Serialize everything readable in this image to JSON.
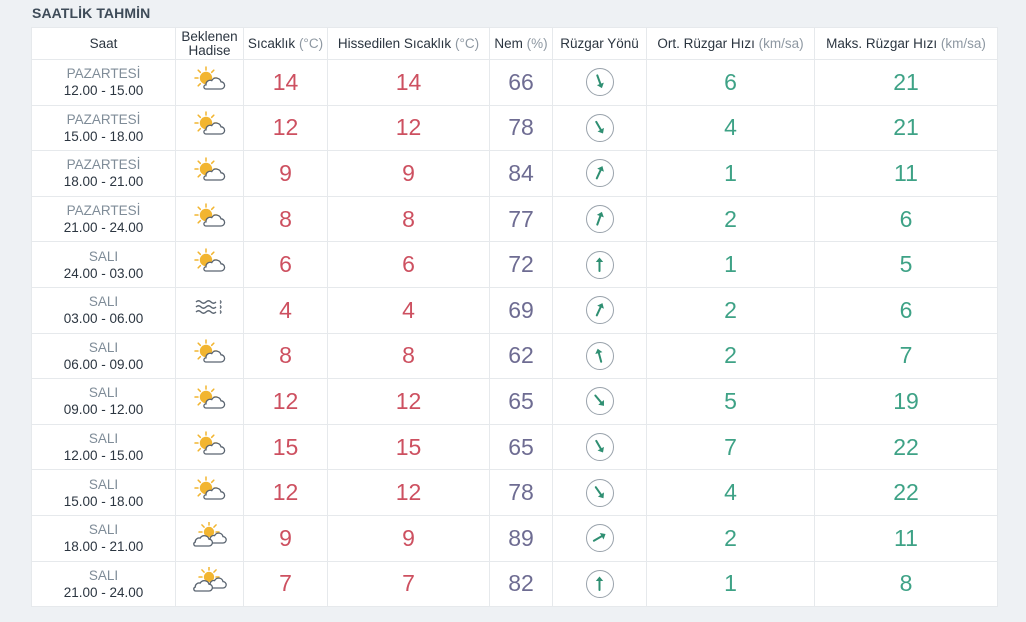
{
  "section_title": "SAATLİK TAHMİN",
  "headers": {
    "saat": "Saat",
    "hadise_line1": "Beklenen",
    "hadise_line2": "Hadise",
    "sicaklik": "Sıcaklık",
    "sicaklik_unit": "(°C)",
    "hissedilen": "Hissedilen Sıcaklık",
    "hissedilen_unit": "(°C)",
    "nem": "Nem",
    "nem_unit": "(%)",
    "ruzgar_yonu": "Rüzgar Yönü",
    "ort_ruzgar": "Ort. Rüzgar Hızı",
    "ort_ruzgar_unit": "(km/sa)",
    "maks_ruzgar": "Maks. Rüzgar Hızı",
    "maks_ruzgar_unit": "(km/sa)"
  },
  "colors": {
    "temperature": "#cd5060",
    "humidity": "#6e6c92",
    "wind_speed": "#3ea286",
    "wind_arrow": "#2f8f72",
    "sun": "#f2b530"
  },
  "rows": [
    {
      "day": "PAZARTESİ",
      "time": "12.00 - 15.00",
      "icon": "partly-cloudy-icon",
      "temp": "14",
      "feels": "14",
      "humidity": "66",
      "wind_dir_deg": 160,
      "avg_wind": "6",
      "max_wind": "21"
    },
    {
      "day": "PAZARTESİ",
      "time": "15.00 - 18.00",
      "icon": "partly-cloudy-icon",
      "temp": "12",
      "feels": "12",
      "humidity": "78",
      "wind_dir_deg": 150,
      "avg_wind": "4",
      "max_wind": "21"
    },
    {
      "day": "PAZARTESİ",
      "time": "18.00 - 21.00",
      "icon": "partly-cloudy-icon",
      "temp": "9",
      "feels": "9",
      "humidity": "84",
      "wind_dir_deg": 25,
      "avg_wind": "1",
      "max_wind": "11"
    },
    {
      "day": "PAZARTESİ",
      "time": "21.00 - 24.00",
      "icon": "partly-cloudy-icon",
      "temp": "8",
      "feels": "8",
      "humidity": "77",
      "wind_dir_deg": 20,
      "avg_wind": "2",
      "max_wind": "6"
    },
    {
      "day": "SALI",
      "time": "24.00 - 03.00",
      "icon": "partly-cloudy-icon",
      "temp": "6",
      "feels": "6",
      "humidity": "72",
      "wind_dir_deg": 0,
      "avg_wind": "1",
      "max_wind": "5"
    },
    {
      "day": "SALI",
      "time": "03.00 - 06.00",
      "icon": "fog-icon",
      "temp": "4",
      "feels": "4",
      "humidity": "69",
      "wind_dir_deg": 25,
      "avg_wind": "2",
      "max_wind": "6"
    },
    {
      "day": "SALI",
      "time": "06.00 - 09.00",
      "icon": "partly-cloudy-icon",
      "temp": "8",
      "feels": "8",
      "humidity": "62",
      "wind_dir_deg": 345,
      "avg_wind": "2",
      "max_wind": "7"
    },
    {
      "day": "SALI",
      "time": "09.00 - 12.00",
      "icon": "partly-cloudy-icon",
      "temp": "12",
      "feels": "12",
      "humidity": "65",
      "wind_dir_deg": 140,
      "avg_wind": "5",
      "max_wind": "19"
    },
    {
      "day": "SALI",
      "time": "12.00 - 15.00",
      "icon": "partly-cloudy-icon",
      "temp": "15",
      "feels": "15",
      "humidity": "65",
      "wind_dir_deg": 150,
      "avg_wind": "7",
      "max_wind": "22"
    },
    {
      "day": "SALI",
      "time": "15.00 - 18.00",
      "icon": "partly-cloudy-icon",
      "temp": "12",
      "feels": "12",
      "humidity": "78",
      "wind_dir_deg": 145,
      "avg_wind": "4",
      "max_wind": "22"
    },
    {
      "day": "SALI",
      "time": "18.00 - 21.00",
      "icon": "mostly-cloudy-icon",
      "temp": "9",
      "feels": "9",
      "humidity": "89",
      "wind_dir_deg": 60,
      "avg_wind": "2",
      "max_wind": "11"
    },
    {
      "day": "SALI",
      "time": "21.00 - 24.00",
      "icon": "mostly-cloudy-icon",
      "temp": "7",
      "feels": "7",
      "humidity": "82",
      "wind_dir_deg": 0,
      "avg_wind": "1",
      "max_wind": "8"
    }
  ]
}
